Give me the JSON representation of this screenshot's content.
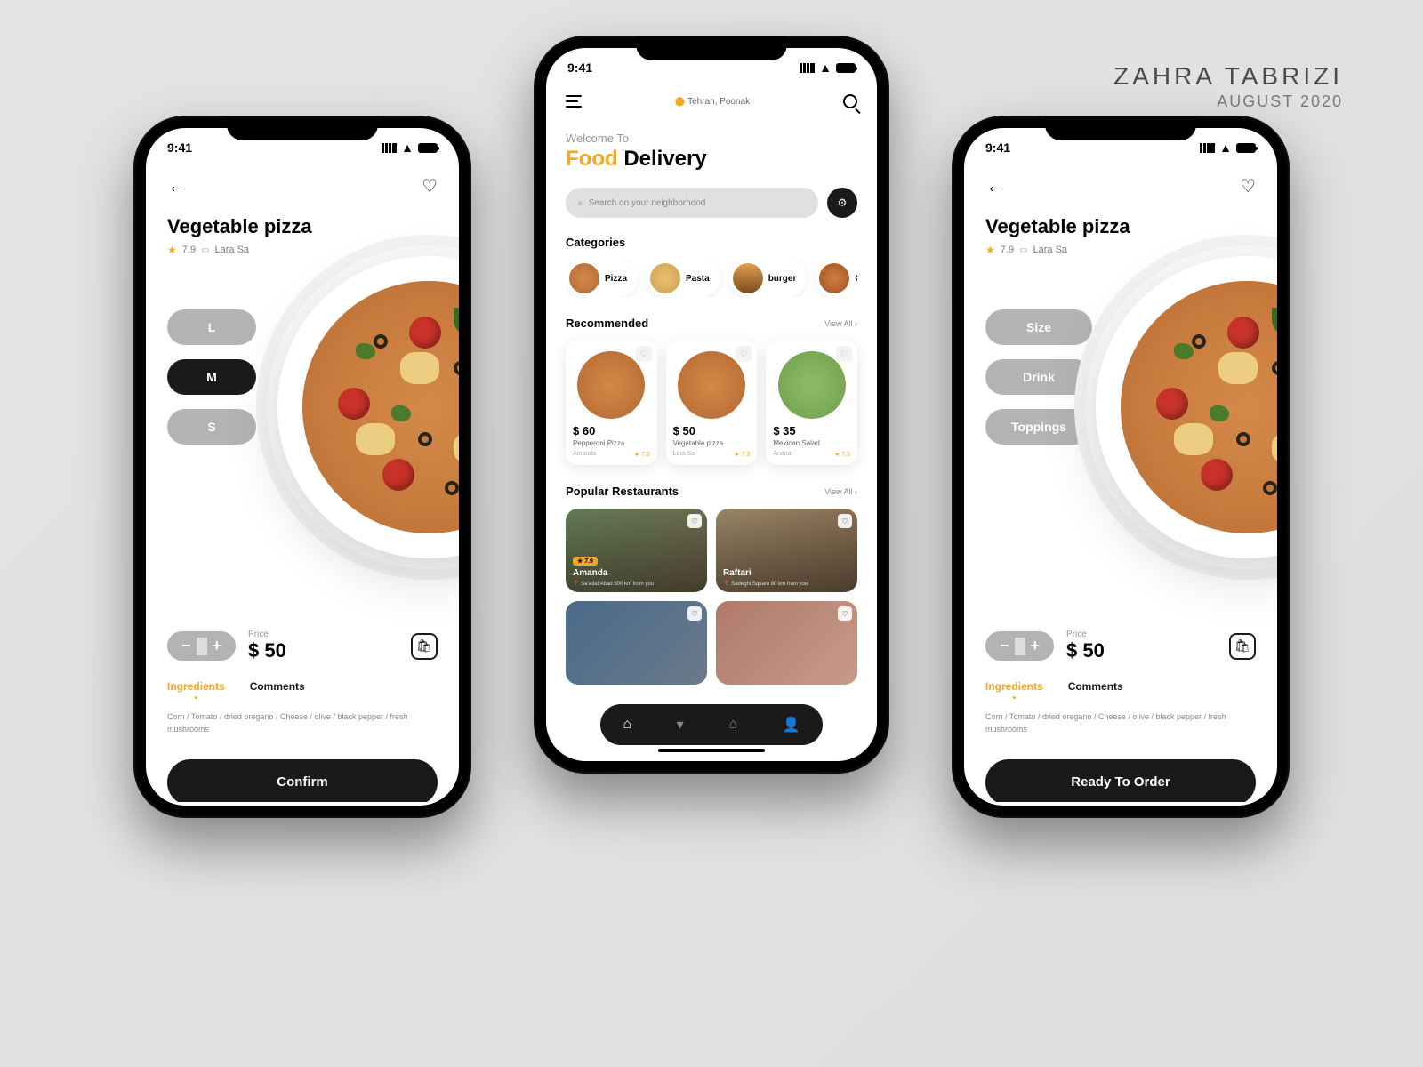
{
  "credit": {
    "name": "ZAHRA TABRIZI",
    "date": "AUGUST 2020"
  },
  "status": {
    "time": "9:41"
  },
  "detail": {
    "title": "Vegetable pizza",
    "rating": "7.9",
    "restaurant": "Lara Sa",
    "sizes": {
      "l": "L",
      "m": "M",
      "s": "S"
    },
    "options": {
      "size": "Size",
      "drink": "Drink",
      "toppings": "Toppings"
    },
    "price_label": "Price",
    "price": "$ 50",
    "tabs": {
      "ingredients": "Ingredients",
      "comments": "Comments"
    },
    "ingredients_text": "Corn / Tomato / dried oregano / Cheese / olive / black pepper / fresh mushrooms",
    "confirm_btn": "Confirm",
    "ready_btn": "Ready To Order",
    "minus": "−",
    "plus": "+"
  },
  "home": {
    "location": "Tehran, Poonak",
    "welcome1": "Welcome To",
    "welcome2a": "Food",
    "welcome2b": "Delivery",
    "search_placeholder": "Search on your neighborhood",
    "cat_title": "Categories",
    "categories": [
      {
        "label": "Pizza"
      },
      {
        "label": "Pasta"
      },
      {
        "label": "burger"
      },
      {
        "label": "Chicken"
      }
    ],
    "rec_title": "Recommended",
    "viewall": "View All  ›",
    "recommended": [
      {
        "price": "$ 60",
        "name": "Pepperoni Pizza",
        "rest": "Amanda",
        "rating": "★ 7.8"
      },
      {
        "price": "$ 50",
        "name": "Vegetable pizza",
        "rest": "Lara Sa",
        "rating": "★ 7.9"
      },
      {
        "price": "$ 35",
        "name": "Mexican Salad",
        "rest": "Ariana",
        "rating": "★ 7.5"
      }
    ],
    "pop_title": "Popular Restaurants",
    "restaurants": [
      {
        "name": "Amanda",
        "addr": "📍 Sa'adat Abad 500 km from you",
        "badge": "★ 7.9"
      },
      {
        "name": "Raftari",
        "addr": "📍 Sadeghi Square 80 km from you",
        "badge": ""
      }
    ]
  }
}
